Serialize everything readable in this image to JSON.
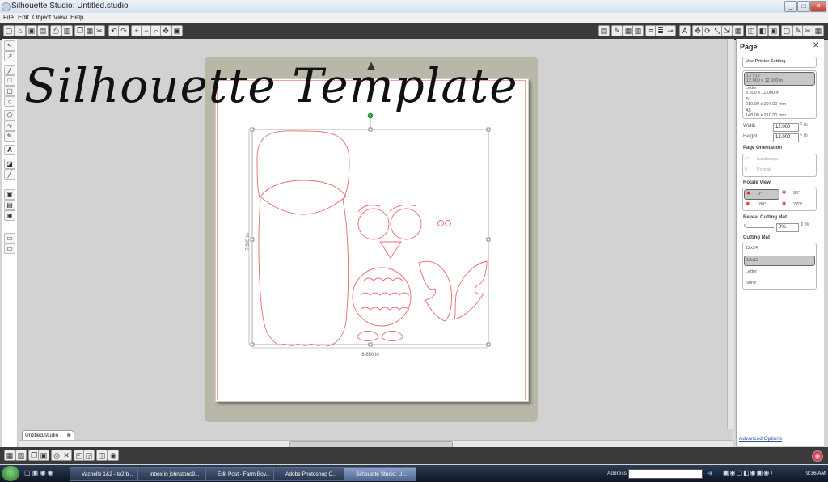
{
  "window": {
    "title": "Silhouette Studio: Untitled.studio",
    "min_label": "_",
    "max_label": "□",
    "close_label": "✕"
  },
  "menu": {
    "items": [
      "File",
      "Edit",
      "Object",
      "View",
      "Help"
    ]
  },
  "overlay_title": "Silhouette Template",
  "canvas": {
    "height_dimension": "7.895 in",
    "width_dimension": "8.850 in"
  },
  "doc_tab": {
    "label": "Untitled.studio"
  },
  "page_panel": {
    "title": "Page",
    "printer_setting": "Use Printer Setting",
    "sizes": [
      {
        "name": "12\"x12\"",
        "dims": "12.000 x 12.000 in",
        "selected": true
      },
      {
        "name": "Letter",
        "dims": "8.500 x 11.000 in",
        "selected": false
      },
      {
        "name": "A4",
        "dims": "210.00 x 297.00 mm",
        "selected": false
      },
      {
        "name": "A5",
        "dims": "148.00 x 210.00 mm",
        "selected": false
      }
    ],
    "width_label": "Width",
    "width_value": "12.000",
    "width_unit": "in",
    "height_label": "Height",
    "height_value": "12.000",
    "height_unit": "in",
    "orientation_label": "Page Orientation",
    "orientation_landscape": "Landscape",
    "orientation_portrait": "Portrait",
    "rotate_label": "Rotate View",
    "rotate_0": "0°",
    "rotate_90": "90°",
    "rotate_180": "180°",
    "rotate_270": "270°",
    "reveal_label": "Reveal Cutting Mat",
    "reveal_min": "0",
    "reveal_value": "0%",
    "reveal_unit": "%",
    "mat_label": "Cutting Mat",
    "mats": [
      "12x24",
      "12x12",
      "Letter",
      "None"
    ],
    "mat_selected": "12x12",
    "advanced": "Advanced Options"
  },
  "taskbar": {
    "tasks": [
      "Vachelle 1&2 - to2.b...",
      "Inbox in johnstonc9...",
      "Edit Post - Farm Boy...",
      "Adobe Photoshop C...",
      "Silhouette Studio: U..."
    ],
    "active_task": 4,
    "address_label": "Address",
    "clock": "9:36 AM"
  }
}
